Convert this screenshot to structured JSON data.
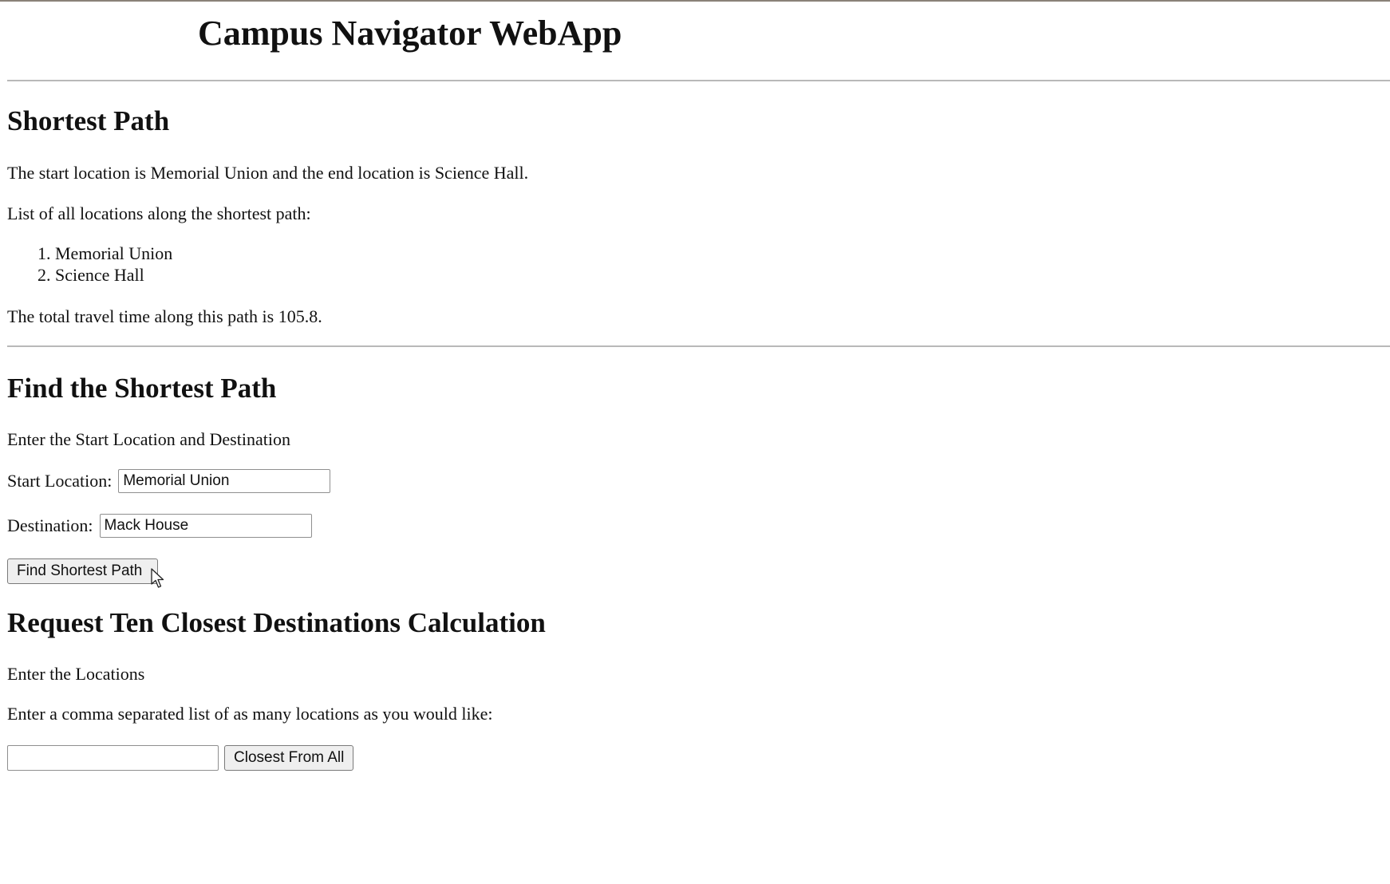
{
  "app": {
    "title": "Campus Navigator WebApp"
  },
  "result": {
    "heading": "Shortest Path",
    "summary": "The start location is Memorial Union and the end location is Science Hall.",
    "list_caption": "List of all locations along the shortest path:",
    "path_locations": [
      "Memorial Union",
      "Science Hall"
    ],
    "total_time_text": "The total travel time along this path is 105.8."
  },
  "find_form": {
    "heading": "Find the Shortest Path",
    "instructions": "Enter the Start Location and Destination",
    "start_label": "Start Location:",
    "start_value": "Memorial Union",
    "destination_label": "Destination:",
    "destination_value": "Mack House",
    "submit_label": "Find Shortest Path"
  },
  "closest_form": {
    "heading": "Request Ten Closest Destinations Calculation",
    "instructions": "Enter the Locations",
    "prompt": "Enter a comma separated list of as many locations as you would like:",
    "locations_value": "",
    "submit_label": "Closest From All"
  },
  "icons": {
    "cursor": "mouse-pointer-icon"
  }
}
